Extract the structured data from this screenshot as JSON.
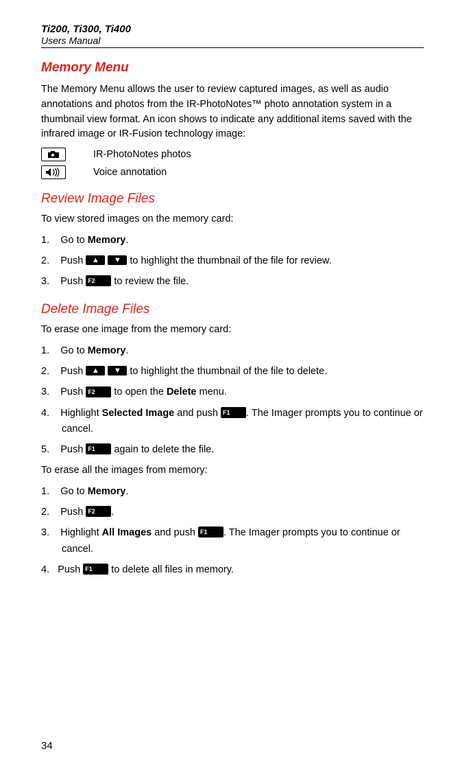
{
  "header": {
    "line1": "Ti200, Ti300, Ti400",
    "line2": "Users Manual"
  },
  "section1": {
    "title": "Memory Menu",
    "intro": "The Memory Menu allows the user to review captured images, as well as audio annotations and photos from the IR-PhotoNotes™ photo annotation system in a thumbnail view format. An icon shows to indicate any additional items saved with the infrared image or IR-Fusion technology image:",
    "iconrows": [
      {
        "label": "IR-PhotoNotes photos"
      },
      {
        "label": "Voice annotation"
      }
    ]
  },
  "section2": {
    "title": "Review Image Files",
    "intro": "To view stored images on the memory card:",
    "steps": {
      "s1a": "Go to ",
      "s1b": "Memory",
      "s1c": ".",
      "s2a": "Push ",
      "s2b": " to highlight the thumbnail of the file for review.",
      "s3a": "Push ",
      "s3b": " to review the file."
    }
  },
  "section3": {
    "title": "Delete Image Files",
    "intro1": "To erase one image from the memory card:",
    "stepsA": {
      "s1a": "Go to ",
      "s1b": "Memory",
      "s1c": ".",
      "s2a": "Push ",
      "s2b": " to highlight the thumbnail of the file to delete.",
      "s3a": "Push ",
      "s3b": " to open the ",
      "s3c": "Delete",
      "s3d": " menu.",
      "s4a": "Highlight ",
      "s4b": "Selected Image",
      "s4c": " and push ",
      "s4d": ". The Imager prompts you to continue or cancel.",
      "s5a": "Push ",
      "s5b": " again to delete the file."
    },
    "intro2": "To erase all the images from memory:",
    "stepsB": {
      "s1a": "Go to ",
      "s1b": "Memory",
      "s1c": ".",
      "s2a": "Push ",
      "s2b": ".",
      "s3a": "Highlight ",
      "s3b": "All Images",
      "s3c": " and push ",
      "s3d": ". The Imager prompts you to continue or cancel.",
      "s4a": "Push ",
      "s4b": " to delete all files in memory."
    }
  },
  "buttons": {
    "up": "▲",
    "down": "▼",
    "f1": "F1",
    "f2": "F2"
  },
  "pagefoot": "34"
}
